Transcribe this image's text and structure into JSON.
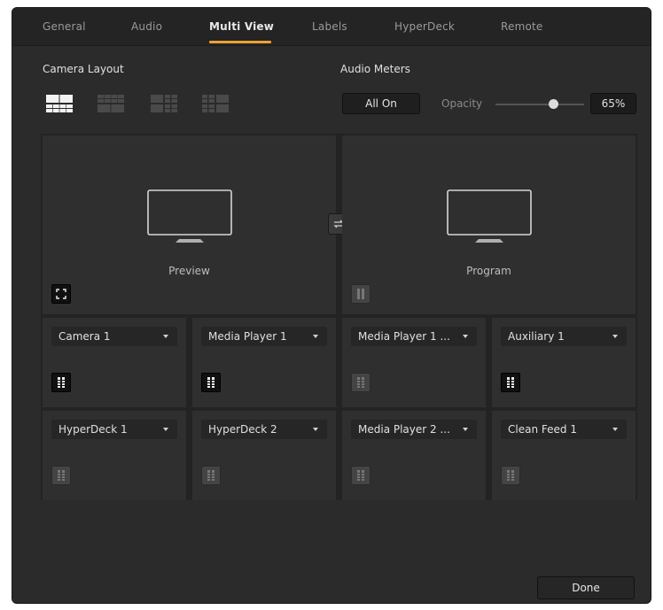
{
  "tabs": [
    {
      "label": "General",
      "active": false
    },
    {
      "label": "Audio",
      "active": false
    },
    {
      "label": "Multi View",
      "active": true
    },
    {
      "label": "Labels",
      "active": false
    },
    {
      "label": "HyperDeck",
      "active": false
    },
    {
      "label": "Remote",
      "active": false
    }
  ],
  "camera_layout": {
    "title": "Camera Layout",
    "options": [
      "layout-1",
      "layout-2",
      "layout-3",
      "layout-4"
    ],
    "selected": 0
  },
  "audio_meters": {
    "title": "Audio Meters",
    "all_on_label": "All On",
    "opacity_label": "Opacity",
    "opacity_value": "65%",
    "opacity_fraction": 0.65
  },
  "preview": {
    "label": "Preview"
  },
  "program": {
    "label": "Program"
  },
  "views": [
    {
      "source": "Camera 1",
      "meter_on": true
    },
    {
      "source": "Media Player 1",
      "meter_on": true
    },
    {
      "source": "Media Player 1 ...",
      "meter_on": false
    },
    {
      "source": "Auxiliary 1",
      "meter_on": true
    },
    {
      "source": "HyperDeck 1",
      "meter_on": false
    },
    {
      "source": "HyperDeck 2",
      "meter_on": false
    },
    {
      "source": "Media Player 2 ...",
      "meter_on": false
    },
    {
      "source": "Clean Feed 1",
      "meter_on": false
    }
  ],
  "footer": {
    "done_label": "Done"
  },
  "colors": {
    "accent": "#f0a030",
    "background": "#2b2b2b"
  }
}
